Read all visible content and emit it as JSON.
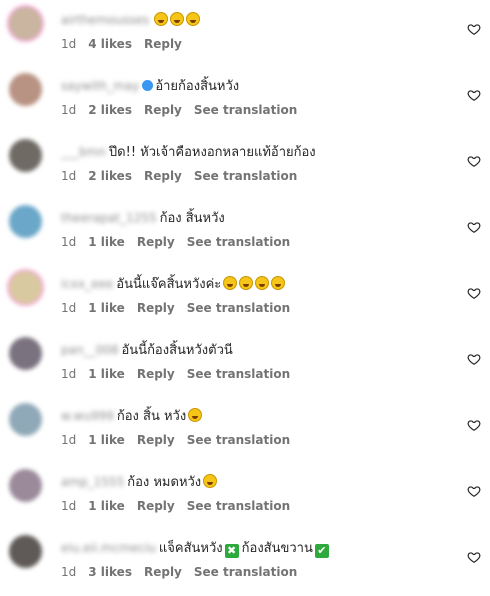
{
  "comments": [
    {
      "username": "airthemousses",
      "text": "",
      "emojis": [
        "😂",
        "😂",
        "😂"
      ],
      "time": "1d",
      "likes": "4 likes",
      "reply": "Reply",
      "see_translation": "",
      "verified": false,
      "avatar_color": "#c9b5a0",
      "ring": true
    },
    {
      "username": "saywith_may",
      "text": "อ้ายก้องสิ้นหวัง",
      "emojis": [],
      "time": "1d",
      "likes": "2 likes",
      "reply": "Reply",
      "see_translation": "See translation",
      "verified": true,
      "avatar_color": "#b89282",
      "ring": false
    },
    {
      "username": "___bmn",
      "text": "ปึด!! หัวเจ้าคือหงอกหลายแท้อ้ายก้อง",
      "emojis": [],
      "time": "1d",
      "likes": "2 likes",
      "reply": "Reply",
      "see_translation": "See translation",
      "verified": false,
      "avatar_color": "#6f6a64",
      "ring": false
    },
    {
      "username": "theerapat_1255",
      "text": "ก้อง สิ้นหวัง",
      "emojis": [],
      "time": "1d",
      "likes": "1 like",
      "reply": "Reply",
      "see_translation": "See translation",
      "verified": false,
      "avatar_color": "#6aa7c8",
      "ring": false
    },
    {
      "username": "icxx_eee",
      "text": "อันนี้แจ๊คสิ้นหวังค่ะ",
      "emojis": [
        "😂",
        "😂",
        "😂",
        "😂"
      ],
      "time": "1d",
      "likes": "1 like",
      "reply": "Reply",
      "see_translation": "See translation",
      "verified": false,
      "avatar_color": "#d9c9a0",
      "ring": true
    },
    {
      "username": "pan__008",
      "text": "อันนี้ก้องสิ้นหวังตัวนี",
      "emojis": [],
      "time": "1d",
      "likes": "1 like",
      "reply": "Reply",
      "see_translation": "See translation",
      "verified": false,
      "avatar_color": "#7b7280",
      "ring": false
    },
    {
      "username": "w.wu999",
      "text": "ก้อง สิ้น หวัง",
      "emojis": [
        "😂"
      ],
      "time": "1d",
      "likes": "1 like",
      "reply": "Reply",
      "see_translation": "See translation",
      "verified": false,
      "avatar_color": "#8fa9b8",
      "ring": false
    },
    {
      "username": "amp_1555",
      "text": "ก้อง หมดหวัง",
      "emojis": [
        "😂"
      ],
      "time": "1d",
      "likes": "1 like",
      "reply": "Reply",
      "see_translation": "See translation",
      "verified": false,
      "avatar_color": "#9a8a9a",
      "ring": false
    },
    {
      "username": "eiu.eii.mcmeciu",
      "text": "แจ็คสันหวัง",
      "text2": "ก้องสันขวาน",
      "marks": [
        "✖",
        "✔"
      ],
      "emojis": [],
      "time": "1d",
      "likes": "3 likes",
      "reply": "Reply",
      "see_translation": "See translation",
      "verified": false,
      "avatar_color": "#5f5a58",
      "ring": false
    }
  ],
  "icons": {
    "like": "heart-outline-icon",
    "emoji": "laughing-emoji-icon",
    "verified": "verified-badge-icon"
  }
}
